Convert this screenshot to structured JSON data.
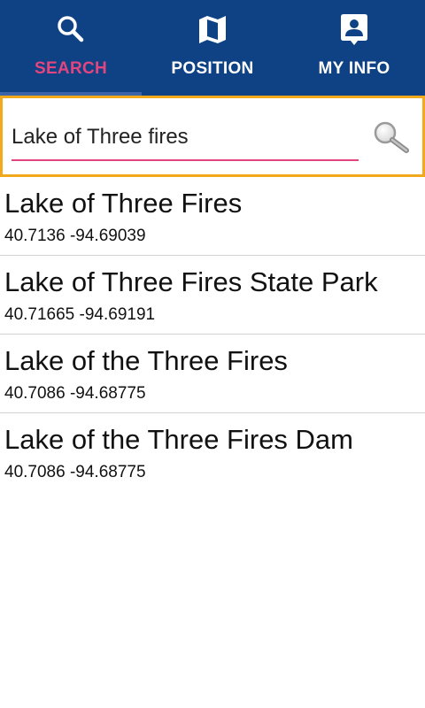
{
  "tabs": [
    {
      "label": "SEARCH",
      "icon": "search-icon",
      "active": true
    },
    {
      "label": "POSITION",
      "icon": "map-icon",
      "active": false
    },
    {
      "label": "MY INFO",
      "icon": "contact-card-icon",
      "active": false
    }
  ],
  "search": {
    "value": "Lake of Three fires",
    "button_icon": "magnifier-icon"
  },
  "results": [
    {
      "name": "Lake of Three Fires",
      "coords": "40.7136 -94.69039"
    },
    {
      "name": "Lake of Three Fires State Park",
      "coords": "40.71665 -94.69191"
    },
    {
      "name": "Lake of the Three Fires",
      "coords": "40.7086 -94.68775"
    },
    {
      "name": "Lake of the Three Fires Dam",
      "coords": "40.7086 -94.68775"
    }
  ],
  "colors": {
    "tabbar": "#0e4285",
    "active_tab": "#e2457f",
    "tab_indicator": "#3b65a8",
    "search_border": "#f2a81b",
    "underline": "#e2457f"
  }
}
